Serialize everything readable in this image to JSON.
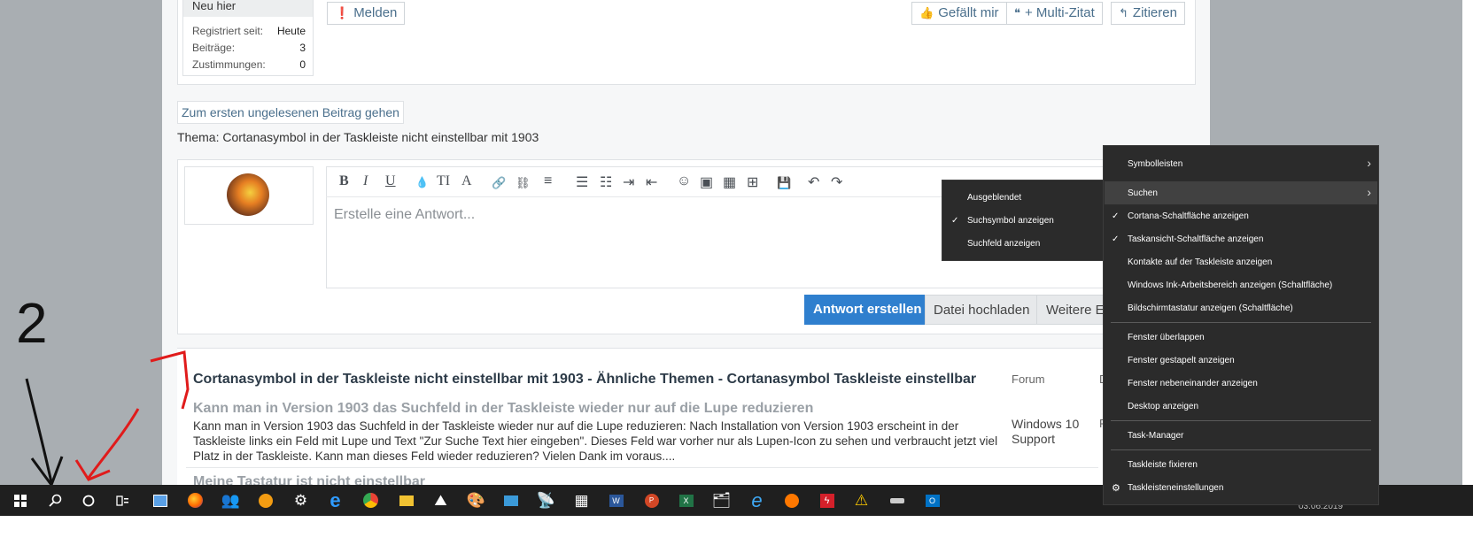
{
  "post": {
    "user_rank": "Neu hier",
    "stats": [
      {
        "label": "Registriert seit:",
        "value": "Heute"
      },
      {
        "label": "Beiträge:",
        "value": "3"
      },
      {
        "label": "Zustimmungen:",
        "value": "0"
      }
    ],
    "report_label": "Melden",
    "like_label": "Gefällt mir",
    "multiquote_label": "+ Multi-Zitat",
    "quote_label": "Zitieren"
  },
  "goto_unread": "Zum ersten ungelesenen Beitrag gehen",
  "thread_line": "Thema: Cortanasymbol in der Taskleiste nicht einstellbar mit 1903",
  "editor": {
    "placeholder": "Erstelle eine Antwort...",
    "toolbar_glyphs": [
      "B",
      "I",
      "U",
      "💧",
      "TI",
      "A",
      "🔗",
      "⛓",
      "≡",
      "☰",
      "☷",
      "⇥",
      "⇤",
      "☺",
      "▣",
      "▦",
      "⊞",
      "💾",
      "↶",
      "↷"
    ],
    "toolbar_icons": [
      "bold-icon",
      "italic-icon",
      "underline-icon",
      "color-icon",
      "font-size-icon",
      "font-icon",
      "link-icon",
      "unlink-icon",
      "align-icon",
      "bullet-list-icon",
      "numbered-list-icon",
      "indent-icon",
      "outdent-icon",
      "smiley-icon",
      "image-icon",
      "media-icon",
      "insert-icon",
      "save-draft-icon",
      "undo-icon",
      "redo-icon"
    ]
  },
  "actions": {
    "reply": "Antwort erstellen",
    "upload": "Datei hochladen",
    "more": "Weitere Ei"
  },
  "similar": {
    "heading": "Cortanasymbol in der Taskleiste nicht einstellbar mit 1903 - Ähnliche Themen - Cortanasymbol Taskleiste einstellbar",
    "col_forum": "Forum",
    "col_d": "D",
    "topics": [
      {
        "title": "Kann man in Version 1903 das Suchfeld in der Taskleiste wieder nur auf die Lupe reduzieren",
        "text": "Kann man in Version 1903 das Suchfeld in der Taskleiste wieder nur auf die Lupe reduzieren: Nach Installation von Version 1903 erscheint in der Taskleiste links ein Feld mit Lupe und Text \"Zur Suche Text hier eingeben\". Dieses Feld war vorher nur als Lupen-Icon zu sehen und verbraucht jetzt viel Platz in der Taskleiste. Kann man dieses Feld wieder reduzieren? Vielen Dank im voraus....",
        "forum": "Windows 10 Support",
        "extra": "F"
      },
      {
        "title": "Meine Tastatur ist nicht einstellbar"
      }
    ]
  },
  "annotation": {
    "number": "2"
  },
  "submenu": {
    "items": [
      {
        "label": "Ausgeblendet",
        "checked": false
      },
      {
        "label": "Suchsymbol anzeigen",
        "checked": true
      },
      {
        "label": "Suchfeld anzeigen",
        "checked": false
      }
    ]
  },
  "context_menu": {
    "items": [
      {
        "label": "Symbolleisten",
        "arrow": true
      },
      {
        "label": "Suchen",
        "arrow": true,
        "highlighted": true
      },
      {
        "label": "Cortana-Schaltfläche anzeigen",
        "checked": true
      },
      {
        "label": "Taskansicht-Schaltfläche anzeigen",
        "checked": true
      },
      {
        "label": "Kontakte auf der Taskleiste anzeigen"
      },
      {
        "label": "Windows Ink-Arbeitsbereich anzeigen (Schaltfläche)"
      },
      {
        "label": "Bildschirmtastatur anzeigen (Schaltfläche)"
      },
      {
        "label": "Fenster überlappen"
      },
      {
        "label": "Fenster gestapelt anzeigen"
      },
      {
        "label": "Fenster nebeneinander anzeigen"
      },
      {
        "label": "Desktop anzeigen"
      },
      {
        "label": "Task-Manager"
      },
      {
        "label": "Taskleiste fixieren"
      },
      {
        "label": "Taskleisteneinstellungen",
        "icon": "gear-icon"
      }
    ]
  },
  "taskbar": {
    "date": "03.06.2019",
    "icons": [
      "windows-start-icon",
      "search-icon",
      "cortana-icon",
      "task-view-icon",
      "app-icon",
      "firefox-icon",
      "people-icon",
      "app-orange-icon",
      "settings-icon",
      "edge-icon",
      "chrome-icon",
      "file-explorer-icon",
      "photos-icon",
      "paint-icon",
      "app-blue-icon",
      "satellite-icon",
      "calculator-icon",
      "word-icon",
      "powerpoint-icon",
      "excel-icon",
      "app-window-icon",
      "internet-explorer-icon",
      "avast-icon",
      "flash-icon",
      "warning-icon",
      "drive-icon",
      "outlook-icon"
    ]
  }
}
